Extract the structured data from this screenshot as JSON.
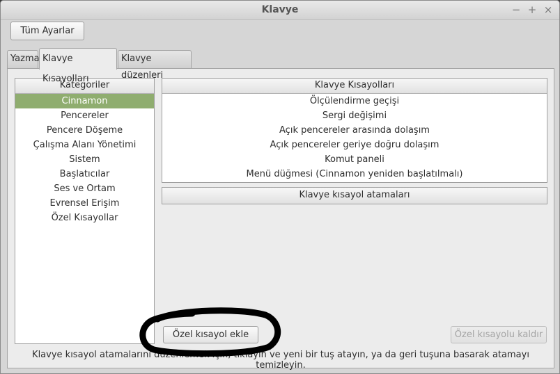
{
  "window": {
    "title": "Klavye",
    "controls": {
      "minimize": "−",
      "maximize": "+",
      "close": "×"
    }
  },
  "toolbar": {
    "all_settings_label": "Tüm Ayarlar"
  },
  "tabs": [
    {
      "label": "Yazma"
    },
    {
      "label": "Klavye Kısayolları"
    },
    {
      "label": "Klavye düzenleri"
    }
  ],
  "categories": {
    "header": "Kategoriler",
    "selected_index": 0,
    "items": [
      "Cinnamon",
      "Pencereler",
      "Pencere Döşeme",
      "Çalışma Alanı Yönetimi",
      "Sistem",
      "Başlatıcılar",
      "Ses ve Ortam",
      "Evrensel Erişim",
      "Özel Kısayollar"
    ]
  },
  "shortcuts": {
    "header": "Klavye Kısayolları",
    "items": [
      "Ölçülendirme geçişi",
      "Sergi değişimi",
      "Açık pencereler arasında dolaşım",
      "Açık pencereler geriye doğru dolaşım",
      "Komut paneli",
      "Menü düğmesi (Cinnamon yeniden başlatılmalı)"
    ]
  },
  "bindings": {
    "header": "Klavye kısayol atamaları"
  },
  "buttons": {
    "add_custom": "Özel kısayol ekle",
    "remove_custom": "Özel kısayolu kaldır"
  },
  "footer": {
    "note": "Klavye kısayol atamalarını düzenlemek için, tıklayın ve yeni bir tuş atayın, ya da geri tuşuna basarak atamayı temizleyin."
  },
  "colors": {
    "selection": "#8fad6f",
    "window_bg": "#d6d6d6",
    "annotation": "#000000"
  }
}
